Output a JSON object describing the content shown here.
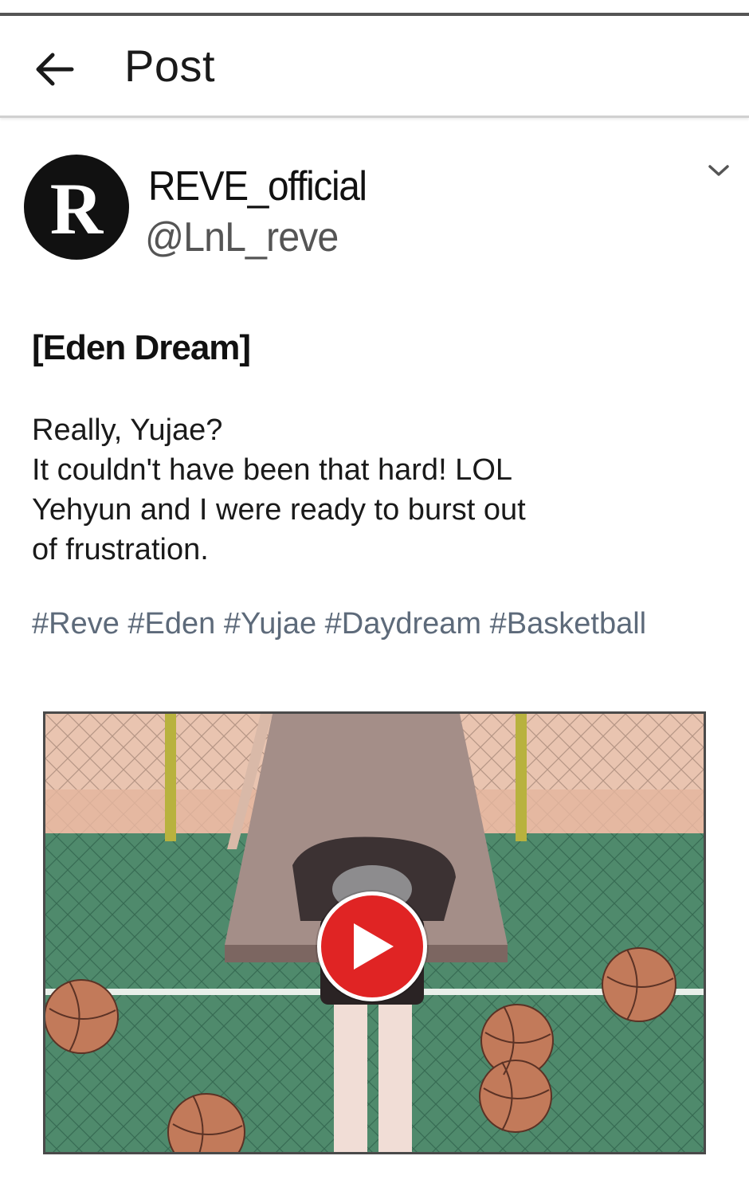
{
  "header": {
    "title": "Post",
    "back_icon": "arrow-left-icon"
  },
  "account": {
    "avatar_letter": "R",
    "name": "REVE_official",
    "handle": "@LnL_reve",
    "more_icon": "chevron-down-icon"
  },
  "post": {
    "title": "[Eden Dream]",
    "lines": [
      "Really, Yujae?",
      "It couldn't have been that hard! LOL",
      "Yehyun and I were ready to burst out",
      "of frustration."
    ],
    "hashtags": [
      "#Reve",
      "#Eden",
      "#Yujae",
      "#Daydream",
      "#Basketball"
    ]
  },
  "media": {
    "type": "video",
    "play_icon": "play-icon"
  },
  "colors": {
    "hashtag": "#5d6a7a",
    "play_button": "#e02424",
    "avatar_bg": "#111111"
  }
}
